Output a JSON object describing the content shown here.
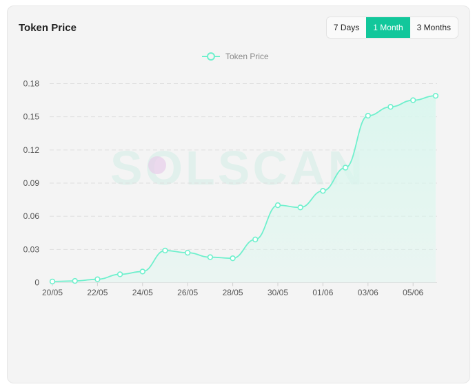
{
  "card": {
    "title": "Token Price",
    "range_buttons": [
      {
        "label": "7 Days",
        "active": false
      },
      {
        "label": "1 Month",
        "active": true
      },
      {
        "label": "3 Months",
        "active": false
      }
    ]
  },
  "watermark": "SOLSCAN",
  "colors": {
    "accent": "#12c79b",
    "line": "#6ff0cd",
    "fill": "#d9f7ee"
  },
  "chart_data": {
    "type": "area",
    "title": "",
    "legend": {
      "position": "top-center",
      "entries": [
        "Token Price"
      ]
    },
    "x_tick_labels": [
      "20/05",
      "22/05",
      "24/05",
      "26/05",
      "28/05",
      "30/05",
      "01/06",
      "03/06",
      "05/06"
    ],
    "y_tick_labels": [
      "0",
      "0.03",
      "0.06",
      "0.09",
      "0.12",
      "0.15",
      "0.18"
    ],
    "ylim": [
      0,
      0.18
    ],
    "grid": "horizontal-dashed",
    "series": [
      {
        "name": "Token Price",
        "x": [
          "20/05",
          "21/05",
          "22/05",
          "23/05",
          "24/05",
          "25/05",
          "26/05",
          "27/05",
          "28/05",
          "29/05",
          "30/05",
          "31/05",
          "01/06",
          "02/06",
          "03/06",
          "04/06",
          "05/06",
          "06/06"
        ],
        "values": [
          0.001,
          0.0015,
          0.003,
          0.0075,
          0.01,
          0.029,
          0.027,
          0.023,
          0.022,
          0.039,
          0.07,
          0.068,
          0.083,
          0.104,
          0.151,
          0.159,
          0.165,
          0.169
        ]
      }
    ]
  }
}
